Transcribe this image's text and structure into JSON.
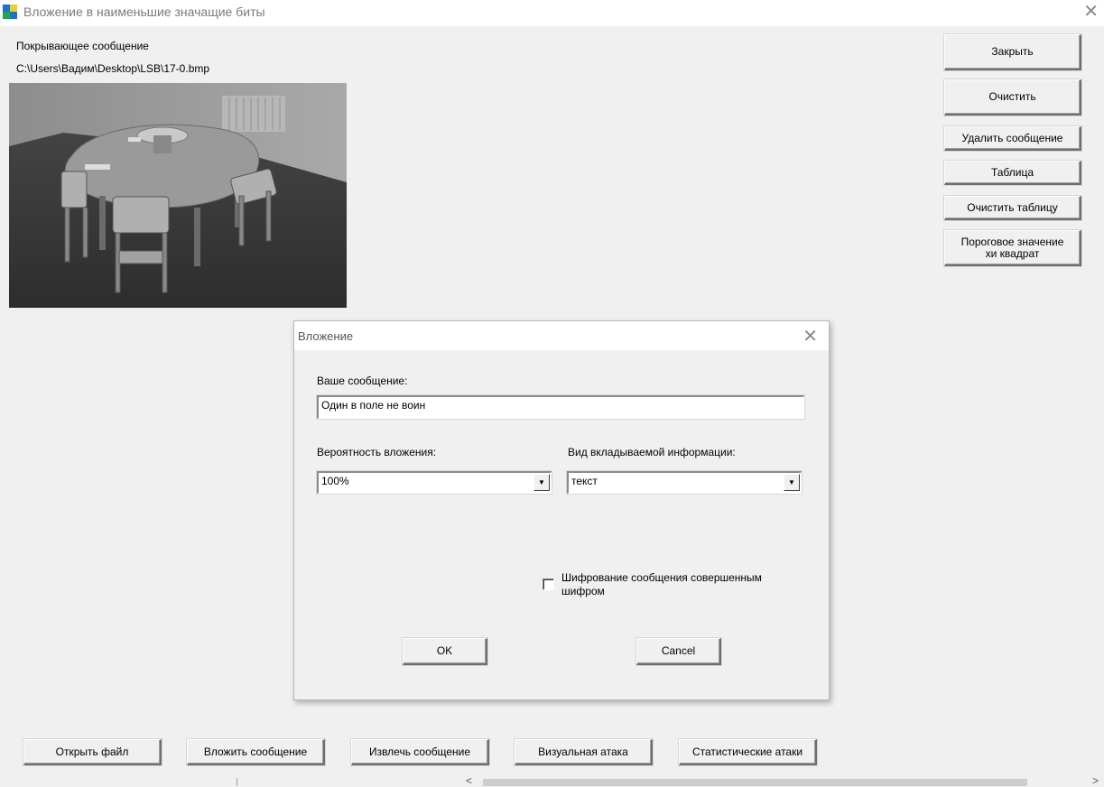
{
  "window": {
    "title": "Вложение в наименьшие значащие биты",
    "close_glyph": "✕"
  },
  "cover": {
    "label": "Покрывающее сообщение",
    "path": "C:\\Users\\Вадим\\Desktop\\LSB\\17-0.bmp"
  },
  "side_buttons": {
    "close": "Закрыть",
    "clear": "Очистить",
    "delete_message": "Удалить сообщение",
    "table": "Таблица",
    "clear_table": "Очистить таблицу",
    "chi_threshold_line1": "Пороговое значение",
    "chi_threshold_line2": "хи квадрат"
  },
  "bottom_buttons": {
    "open_file": "Открыть файл",
    "embed": "Вложить сообщение",
    "extract": "Извлечь сообщение",
    "visual_attack": "Визуальная атака",
    "statistical_attacks": "Статистические атаки"
  },
  "dialog": {
    "title": "Вложение",
    "close_glyph": "✕",
    "message_label": "Ваше сообщение:",
    "message_value": "Один в поле не воин",
    "probability_label": "Вероятность вложения:",
    "probability_value": "100%",
    "info_type_label": "Вид вкладываемой информации:",
    "info_type_value": "текст",
    "encrypt_label_line1": "Шифрование сообщения совершенным",
    "encrypt_label_line2": "шифром",
    "encrypt_checked": false,
    "ok": "OK",
    "cancel": "Cancel"
  },
  "scrollbar": {
    "left_arrow": "<",
    "right_arrow": ">"
  },
  "icons": [
    "app-icon",
    "close-icon",
    "dropdown-arrow-icon",
    "checkbox"
  ]
}
